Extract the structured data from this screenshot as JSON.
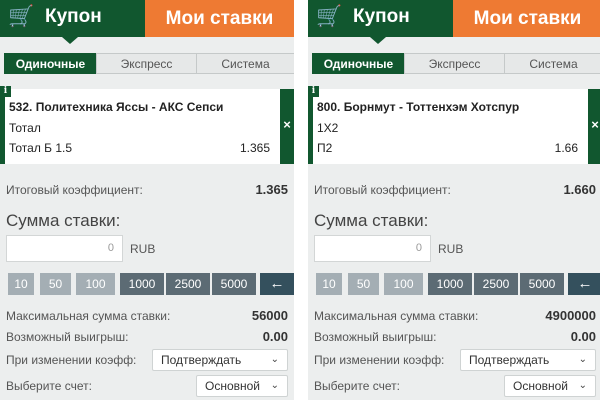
{
  "panels": [
    {
      "header": {
        "cart_icon": "cart-check-icon",
        "cart_glyph": "🛒",
        "coupon_label": "Купон",
        "my_bets_label": "Мои ставки"
      },
      "bet_types": [
        "Одиночные",
        "Экспресс",
        "Система"
      ],
      "active_bet_type": "Одиночные",
      "event": {
        "title": "532. Политехника Яссы - АКС Сепси",
        "market": "Тотал",
        "selection": "Тотал Б 1.5",
        "odds": "1.365",
        "info_glyph": "i",
        "close_glyph": "×"
      },
      "total_coef_label": "Итоговый коэффициент:",
      "total_coef_value": "1.365",
      "stake_title": "Сумма ставки:",
      "stake_value": "0",
      "currency": "RUB",
      "quick_amounts": [
        "10",
        "50",
        "100",
        "1000",
        "2500",
        "5000"
      ],
      "backspace_glyph": "←",
      "max_stake_label": "Максимальная сумма ставки:",
      "max_stake_value": "56000",
      "possible_win_label": "Возможный выигрыш:",
      "possible_win_value": "0.00",
      "on_coef_change_label": "При изменении коэфф:",
      "on_coef_change_value": "Подтверждать",
      "account_label": "Выберите счет:",
      "account_value": "Основной",
      "chevron_glyph": "⌄"
    },
    {
      "header": {
        "cart_icon": "cart-check-icon",
        "cart_glyph": "🛒",
        "coupon_label": "Купон",
        "my_bets_label": "Мои ставки"
      },
      "bet_types": [
        "Одиночные",
        "Экспресс",
        "Система"
      ],
      "active_bet_type": "Одиночные",
      "event": {
        "title": "800. Борнмут - Тоттенхэм Хотспур",
        "market": "1Х2",
        "selection": "П2",
        "odds": "1.66",
        "info_glyph": "i",
        "close_glyph": "×"
      },
      "total_coef_label": "Итоговый коэффициент:",
      "total_coef_value": "1.660",
      "stake_title": "Сумма ставки:",
      "stake_value": "0",
      "currency": "RUB",
      "quick_amounts": [
        "10",
        "50",
        "100",
        "1000",
        "2500",
        "5000"
      ],
      "backspace_glyph": "←",
      "max_stake_label": "Максимальная сумма ставки:",
      "max_stake_value": "4900000",
      "possible_win_label": "Возможный выигрыш:",
      "possible_win_value": "0.00",
      "on_coef_change_label": "При изменении коэфф:",
      "on_coef_change_value": "Подтверждать",
      "account_label": "Выберите счет:",
      "account_value": "Основной",
      "chevron_glyph": "⌄"
    }
  ],
  "colors": {
    "brand_green": "#11572f",
    "accent_orange": "#ee7a33",
    "quick_light": "#a4aeb4",
    "quick_dark": "#5c6b74",
    "backspace": "#34505d"
  }
}
